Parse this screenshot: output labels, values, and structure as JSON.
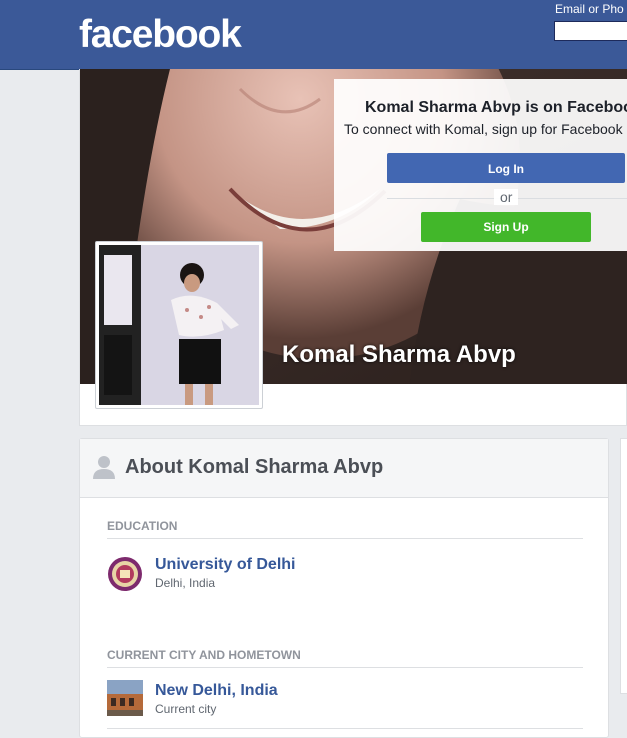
{
  "header": {
    "logo": "facebook",
    "login_label": "Email or Pho",
    "email_value": ""
  },
  "profile": {
    "name": "Komal Sharma Abvp"
  },
  "signup_box": {
    "title": "Komal Sharma Abvp is on Faceboo",
    "subtitle": "To connect with Komal, sign up for Facebook",
    "login_button": "Log In",
    "or_text": "or",
    "signup_button": "Sign Up"
  },
  "about": {
    "title": "About Komal Sharma Abvp",
    "sections": [
      {
        "label": "EDUCATION",
        "entry_name": "University of Delhi",
        "entry_sub": "Delhi, India",
        "icon": "university-seal-icon"
      },
      {
        "label": "CURRENT CITY AND HOMETOWN",
        "entry_name": "New Delhi, India",
        "entry_sub": "Current city",
        "icon": "city-photo-icon"
      }
    ]
  },
  "colors": {
    "brand_blue": "#3b5998",
    "button_blue": "#4267b2",
    "signup_green": "#42b72a",
    "link_blue": "#365899",
    "page_bg": "#e9ebee"
  }
}
